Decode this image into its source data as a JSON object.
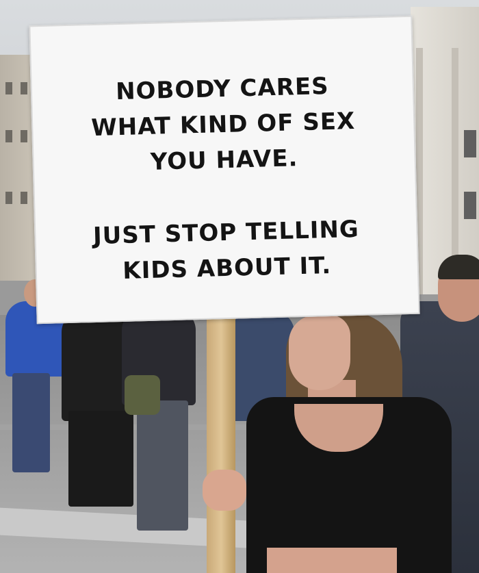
{
  "photo": {
    "subject": "protest-sign-photo",
    "sign": {
      "lines": [
        "NOBODY CARES",
        "WHAT KIND OF SEX",
        "YOU HAVE.",
        "JUST STOP TELLING",
        "KIDS ABOUT IT."
      ]
    },
    "colors": {
      "sign_background": "#f7f7f7",
      "sign_text": "#141414",
      "stick": "#d8bb88",
      "woman_top": "#141414",
      "jacket_blue": "#2f56b8"
    }
  }
}
